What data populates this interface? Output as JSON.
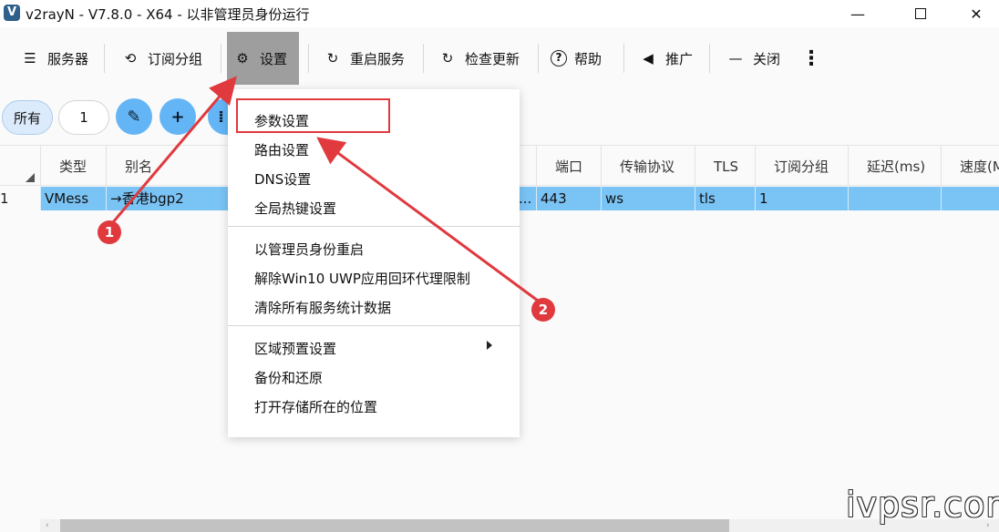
{
  "window": {
    "title": "v2rayN - V7.8.0 - X64 - 以非管理员身份运行",
    "icon_letter": "V",
    "controls": {
      "minimize": "—",
      "close": "✕"
    }
  },
  "toolbar": {
    "items": [
      {
        "label": "服务器",
        "icon": "server-icon",
        "glyph": "☰"
      },
      {
        "label": "订阅分组",
        "icon": "subscription-icon",
        "glyph": "⟲"
      },
      {
        "label": "设置",
        "icon": "gear-icon",
        "glyph": "⚙",
        "active": true
      },
      {
        "label": "重启服务",
        "icon": "restart-icon",
        "glyph": "↻"
      },
      {
        "label": "检查更新",
        "icon": "update-icon",
        "glyph": "↻"
      },
      {
        "label": "帮助",
        "icon": "help-icon",
        "glyph": "?"
      },
      {
        "label": "推广",
        "icon": "speaker-icon",
        "glyph": "◀"
      },
      {
        "label": "关闭",
        "icon": "minus-icon",
        "glyph": "—"
      }
    ],
    "more_glyph": "⋮"
  },
  "filter": {
    "all_label": "所有",
    "count": "1",
    "edit_glyph": "✎",
    "add_glyph": "+",
    "more_glyph": "⁞"
  },
  "table": {
    "columns": [
      "类型",
      "别名",
      "端口",
      "传输协议",
      "TLS",
      "订阅分组",
      "延迟(ms)",
      "速度(M"
    ],
    "rows": [
      {
        "index": "1",
        "type": "VMess",
        "alias": "→香港bgp2",
        "address_tail": "...",
        "port": "443",
        "transport": "ws",
        "tls": "tls",
        "group": "1",
        "latency": "",
        "speed": ""
      }
    ]
  },
  "settings_menu": {
    "group1": [
      "参数设置",
      "路由设置",
      "DNS设置",
      "全局热键设置"
    ],
    "group2": [
      "以管理员身份重启",
      "解除Win10 UWP应用回环代理限制",
      "清除所有服务统计数据"
    ],
    "group3": [
      "区域预置设置",
      "备份和还原",
      "打开存储所在的位置"
    ]
  },
  "annotations": {
    "badge1": "1",
    "badge2": "2",
    "color": "#e0393e"
  },
  "watermark": "ivpsr.com",
  "scrollbar": {
    "left_glyph": "‹",
    "right_glyph": "›"
  }
}
